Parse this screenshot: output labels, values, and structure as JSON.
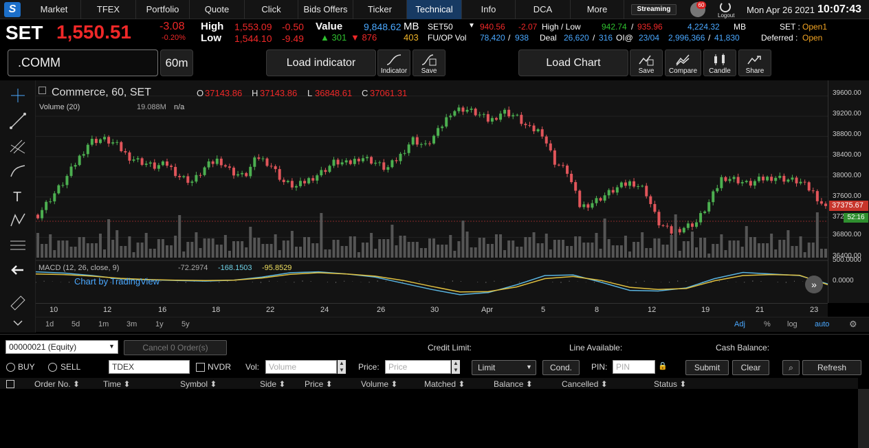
{
  "nav": {
    "tabs": [
      "Market",
      "TFEX",
      "Portfolio",
      "Quote",
      "Click",
      "Bids Offers",
      "Ticker",
      "Technical",
      "Info",
      "DCA",
      "More"
    ],
    "streaming": "Streaming",
    "notif_count": "60",
    "logout": "Logout",
    "date": "Mon Apr 26 2021",
    "time": "10:07:43"
  },
  "quote": {
    "symbol": "SET",
    "price": "1,550.51",
    "chg": "-3.08",
    "pchg": "-0.20%",
    "high_label": "High",
    "high": "1,553.09",
    "high_chg": "-0.50",
    "low_label": "Low",
    "low": "1,544.10",
    "low_chg": "-9.49",
    "value_label": "Value",
    "value": "9,848.62",
    "value_unit": "MB",
    "up": "▲ 301",
    "down": "▼ 876",
    "unch": "403",
    "idx": "SET50",
    "idx_val": "940.56",
    "idx_chg": "-2.07",
    "hl_label": "High / Low",
    "idx_high": "942.74",
    "idx_low": "935.96",
    "idx_value": "4,224.32",
    "idx_unit": "MB",
    "fu_label": "FU/OP Vol",
    "fu1": "78,420",
    "fu2": "938",
    "deal_label": "Deal",
    "deal1": "26,620",
    "deal2": "316",
    "oi_label": "OI@",
    "oi_date": "23/04",
    "oi1": "2,996,366",
    "oi2": "41,830",
    "set_label": "SET :",
    "set_state": "Open1",
    "def_label": "Deferred :",
    "def_state": "Open"
  },
  "toolbar": {
    "symbol": ".COMM",
    "interval": "60m",
    "load_indicator": "Load indicator",
    "indicator": "Indicator",
    "save": "Save",
    "load_chart": "Load Chart",
    "compare": "Compare",
    "candle": "Candle",
    "share": "Share"
  },
  "legend": {
    "title": "Commerce, 60, SET",
    "o": "37143.86",
    "h": "37143.86",
    "l": "36848.61",
    "c": "37061.31",
    "vol_label": "Volume (20)",
    "vol_val": "19.088M",
    "vol_na": "n/a",
    "macd_label": "MACD (12, 26, close, 9)",
    "macd1": "-72.2974",
    "macd2": "-168.1503",
    "macd3": "-95.8529",
    "tv": "Chart by TradingView"
  },
  "yaxis": {
    "labels": [
      "39600.00",
      "39200.00",
      "38800.00",
      "38400.00",
      "38000.00",
      "37600.00",
      "37200.00",
      "36800.00",
      "36400.00",
      "500.0000",
      "0.0000"
    ],
    "last": "37375.67",
    "countdown": "52:16"
  },
  "xaxis": {
    "labels": [
      "10",
      "12",
      "16",
      "18",
      "22",
      "24",
      "26",
      "30",
      "Apr",
      "5",
      "8",
      "12",
      "19",
      "21",
      "23"
    ]
  },
  "ranges": {
    "items": [
      "1d",
      "5d",
      "1m",
      "3m",
      "1y",
      "5y"
    ],
    "adj": "Adj",
    "pct": "%",
    "log": "log",
    "auto": "auto"
  },
  "order": {
    "account": "00000021 (Equity)",
    "cancel": "Cancel 0 Order(s)",
    "credit_label": "Credit Limit:",
    "line_label": "Line Available:",
    "cash_label": "Cash Balance:",
    "buy": "BUY",
    "sell": "SELL",
    "symbol": "TDEX",
    "nvdr": "NVDR",
    "vol_label": "Vol:",
    "vol_ph": "Volume",
    "price_label": "Price:",
    "price_ph": "Price",
    "type": "Limit",
    "cond": "Cond.",
    "pin_label": "PIN:",
    "pin_ph": "PIN",
    "submit": "Submit",
    "clear": "Clear",
    "refresh": "Refresh",
    "cols": [
      "Order No.",
      "Time",
      "Symbol",
      "Side",
      "Price",
      "Volume",
      "Matched",
      "Balance",
      "Cancelled",
      "Status"
    ]
  },
  "chart_data": {
    "type": "candlestick",
    "series_close": [
      37250,
      37580,
      37900,
      38300,
      38700,
      38750,
      38650,
      38400,
      38300,
      38200,
      38250,
      38000,
      37900,
      38200,
      38350,
      38100,
      38000,
      38400,
      38250,
      37900,
      37800,
      37950,
      38100,
      38300,
      38250,
      38400,
      38300,
      38150,
      38400,
      38750,
      38600,
      38900,
      39300,
      39350,
      39250,
      39100,
      39300,
      39200,
      38950,
      38900,
      38300,
      38100,
      37400,
      37500,
      37650,
      37800,
      37900,
      37750,
      37100,
      36900,
      37000,
      37100,
      37500,
      38000,
      37950,
      37850,
      37950,
      38000,
      37950,
      37900,
      37700,
      37380
    ],
    "ylim": [
      36400,
      39800
    ],
    "macd_line": [
      320,
      280,
      200,
      90,
      60,
      40,
      20,
      50,
      150,
      290,
      320,
      250,
      150,
      -50,
      -250,
      -420,
      -350,
      -100,
      200,
      220,
      -20,
      -280,
      -300,
      -200,
      100,
      300,
      250,
      200,
      -72
    ],
    "signal_line": [
      250,
      230,
      180,
      110,
      70,
      50,
      40,
      50,
      120,
      240,
      290,
      250,
      180,
      40,
      -150,
      -330,
      -320,
      -170,
      100,
      170,
      40,
      -180,
      -250,
      -220,
      30,
      200,
      230,
      210,
      -96
    ],
    "macd_ylim": [
      -600,
      600
    ]
  }
}
